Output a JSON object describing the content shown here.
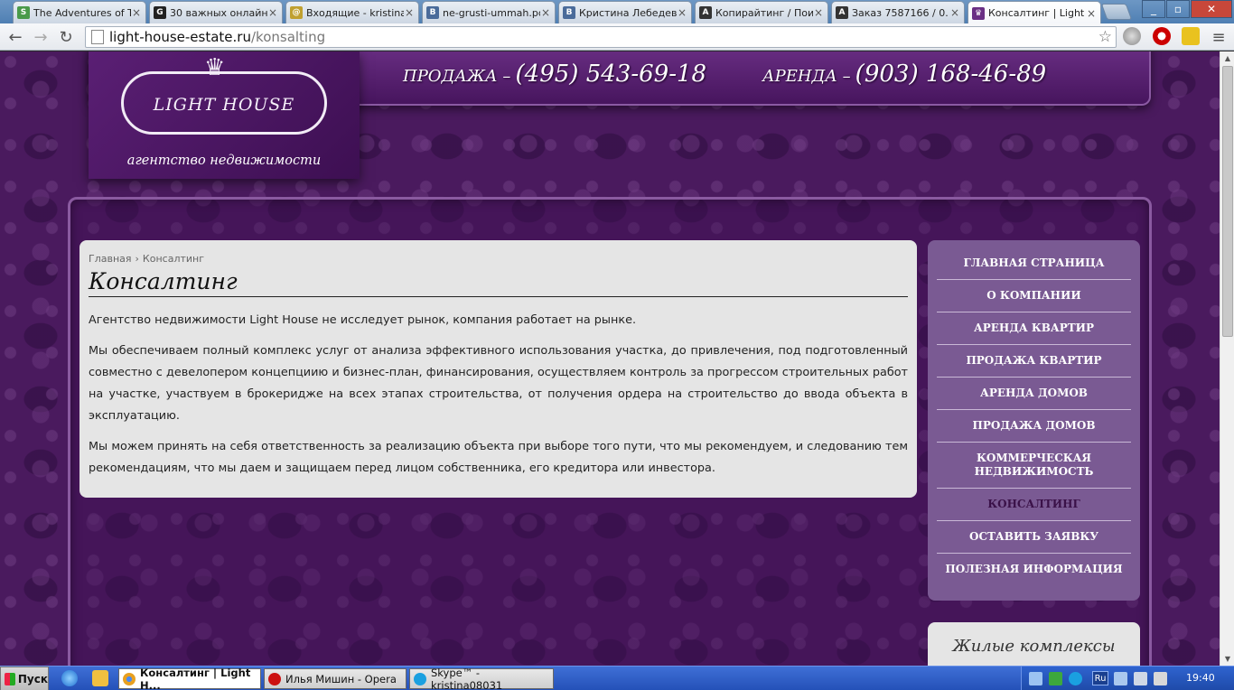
{
  "browser": {
    "tabs": [
      {
        "title": "The Adventures of T",
        "icon": "s-icon",
        "color": "#4a9a4a"
      },
      {
        "title": "30 важных онлайн",
        "icon": "g-icon",
        "color": "#222222"
      },
      {
        "title": "Входящие - kristina",
        "icon": "mail-icon",
        "color": "#c0a030"
      },
      {
        "title": "ne-grusti-ummah.pd",
        "icon": "vk-icon",
        "color": "#4a6b9a"
      },
      {
        "title": "Кристина Лебедев",
        "icon": "vk-icon",
        "color": "#4a6b9a"
      },
      {
        "title": "Копирайтинг / Пои",
        "icon": "a-icon",
        "color": "#333333"
      },
      {
        "title": "Заказ 7587166 / 0.",
        "icon": "a-icon",
        "color": "#333333"
      },
      {
        "title": "Консалтинг | Light H",
        "icon": "lighthouse-icon",
        "color": "#6a2f84"
      }
    ],
    "url_host": "light-house-estate.ru",
    "url_path": "/konsalting"
  },
  "site": {
    "logo_name": "LIGHT HOUSE",
    "logo_sub": "агентство недвижимости",
    "sale_label": "ПРОДАЖА –",
    "sale_phone": "(495) 543-69-18",
    "rent_label": "АРЕНДА –",
    "rent_phone": "(903) 168-46-89"
  },
  "breadcrumb": {
    "home": "Главная",
    "separator": "›",
    "current": "Консалтинг"
  },
  "article": {
    "title": "Консалтинг",
    "paragraphs": [
      "Агентство недвижимости Light House не исследует рынок, компания работает на рынке.",
      "Мы обеспечиваем полный комплекс услуг от анализа эффективного использования участка, до привлечения, под подготовленный совместно с девелопером концепциию и бизнес-план, финансирования, осуществляем контроль за прогрессом строительных работ на участке, участвуем в брокеридже на всех этапах строительства, от получения ордера на строительство до ввода объекта в эксплуатацию.",
      "Мы можем принять на себя ответственность за реализацию объекта при выборе того пути, что мы рекомендуем, и следованию тем рекомендациям, что мы даем и защищаем перед лицом собственника, его кредитора или инвестора."
    ]
  },
  "menu": {
    "items": [
      "ГЛАВНАЯ СТРАНИЦА",
      "О КОМПАНИИ",
      "АРЕНДА КВАРТИР",
      "ПРОДАЖА КВАРТИР",
      "АРЕНДА ДОМОВ",
      "ПРОДАЖА ДОМОВ",
      "КОММЕРЧЕСКАЯ НЕДВИЖИМОСТЬ",
      "КОНСАЛТИНГ",
      "ОСТАВИТЬ ЗАЯВКУ",
      "ПОЛЕЗНАЯ ИНФОРМАЦИЯ"
    ],
    "current": "КОНСАЛТИНГ"
  },
  "complexes": {
    "title": "Жилые комплексы"
  },
  "taskbar": {
    "start": "Пуск",
    "tasks": [
      {
        "title": "Консалтинг | Light H...",
        "color": "#e8a020"
      },
      {
        "title": "Илья Мишин - Opera",
        "color": "#cc1111"
      },
      {
        "title": "Skype™ - kristina08031",
        "color": "#1aa0e0"
      }
    ],
    "lang": "Ru",
    "time": "19:40"
  },
  "colors": {
    "brand_purple": "#4a1a5e",
    "menu_bg": "#7a5a93",
    "content_bg": "#e5e5e5"
  }
}
